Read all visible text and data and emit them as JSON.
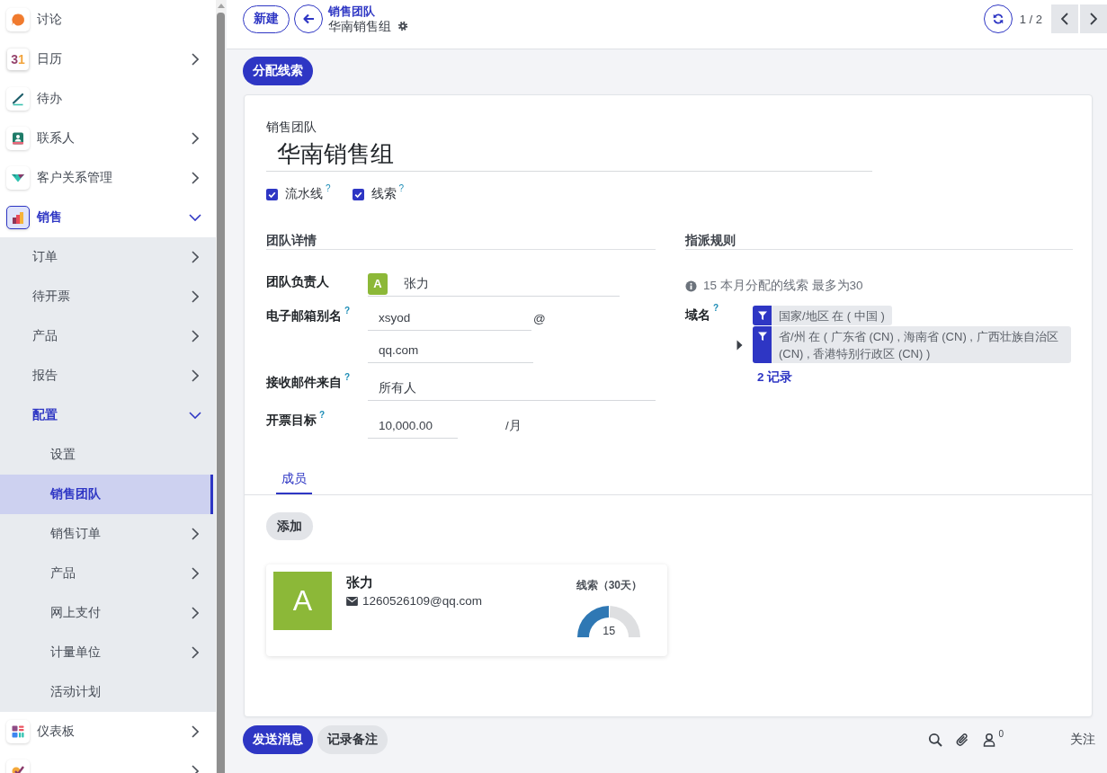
{
  "sidebar": {
    "items": [
      {
        "label": "讨论",
        "expandable": false,
        "selected": false
      },
      {
        "label": "日历",
        "icon_text": "31",
        "expandable": true,
        "expanded": false,
        "selected": false
      },
      {
        "label": "待办",
        "expandable": false,
        "selected": false
      },
      {
        "label": "联系人",
        "expandable": true,
        "expanded": false,
        "selected": false
      },
      {
        "label": "客户关系管理",
        "expandable": true,
        "expanded": false,
        "selected": false
      },
      {
        "label": "销售",
        "expandable": true,
        "expanded": true,
        "selected": false,
        "children": [
          {
            "label": "订单",
            "expandable": true,
            "expanded": false,
            "selected": false
          },
          {
            "label": "待开票",
            "expandable": true,
            "expanded": false,
            "selected": false
          },
          {
            "label": "产品",
            "expandable": true,
            "expanded": false,
            "selected": false
          },
          {
            "label": "报告",
            "expandable": true,
            "expanded": false,
            "selected": false
          },
          {
            "label": "配置",
            "expandable": true,
            "expanded": true,
            "selected": false,
            "children": [
              {
                "label": "设置",
                "expandable": false,
                "selected": false
              },
              {
                "label": "销售团队",
                "expandable": false,
                "selected": true
              },
              {
                "label": "销售订单",
                "expandable": true,
                "expanded": false,
                "selected": false
              },
              {
                "label": "产品",
                "expandable": true,
                "expanded": false,
                "selected": false
              },
              {
                "label": "网上支付",
                "expandable": true,
                "expanded": false,
                "selected": false
              },
              {
                "label": "计量单位",
                "expandable": true,
                "expanded": false,
                "selected": false
              },
              {
                "label": "活动计划",
                "expandable": false,
                "selected": false
              }
            ]
          }
        ]
      },
      {
        "label": "仪表板",
        "expandable": true,
        "expanded": false,
        "selected": false
      },
      {
        "expandable": true,
        "expanded": false,
        "selected": false
      }
    ]
  },
  "control_panel": {
    "new_button": "新建",
    "breadcrumb": {
      "parent": "销售团队",
      "current": "华南销售组"
    },
    "pager": "1 / 2"
  },
  "action_buttons": [
    "分配线索"
  ],
  "form": {
    "title_label": "销售团队",
    "title": "华南销售组",
    "options": [
      {
        "label": "流水线",
        "help": "?",
        "checked": true
      },
      {
        "label": "线索",
        "help": "?",
        "checked": true
      }
    ],
    "groups": [
      {
        "title": "团队详情",
        "fields": [
          {
            "kind": "user",
            "label": "团队负责人",
            "avatar": "A",
            "value": "张力"
          },
          {
            "kind": "alias",
            "label": "电子邮箱别名",
            "help": "?",
            "value": "xsyod",
            "separator": "@",
            "domain": "qq.com"
          },
          {
            "kind": "text",
            "label": "接收邮件来自",
            "help": "?",
            "value": "所有人"
          },
          {
            "kind": "amount",
            "label": "开票目标",
            "help": "?",
            "value": "10,000.00",
            "unit": "/月"
          }
        ]
      },
      {
        "title": "指派规则",
        "fields": [
          {
            "kind": "info",
            "value": "15 本月分配的线索 最多为30"
          },
          {
            "kind": "domain",
            "label": "域名",
            "help": "?",
            "expanded": false,
            "filters": [
              "国家/地区 在 ( 中国 )",
              "省/州 在 ( 广东省 (CN) , 海南省 (CN) , 广西壮族自治区 (CN) , 香港特别行政区 (CN) )"
            ],
            "link": "2 记录"
          }
        ]
      }
    ],
    "tabs": [
      {
        "label": "成员",
        "selected": true
      }
    ],
    "members": {
      "add_button": "添加",
      "cards": [
        {
          "avatar": "A",
          "name": "张力",
          "email": "1260526109@qq.com",
          "stat_title": "线索（30天）",
          "stat_value": "15",
          "level": 0.5
        }
      ]
    }
  },
  "chatter": {
    "buttons": [
      {
        "label": "发送消息",
        "kind": "primary"
      },
      {
        "label": "记录备注",
        "kind": "secondary"
      }
    ],
    "followers": "0",
    "follow": "关注"
  }
}
